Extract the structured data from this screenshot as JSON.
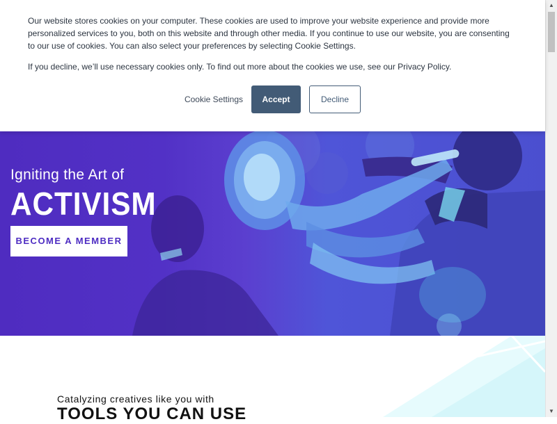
{
  "cookie_banner": {
    "paragraph_1": "Our website stores cookies on your computer. These cookies are used to improve your website experience and provide more personalized services to you, both on this website and through other media. If you continue to use our website, you are consenting to our use of cookies. You can also select your preferences by selecting Cookie Settings.",
    "paragraph_2": "If you decline, we’ll use necessary cookies only. To find out more about the cookies we use, see our Privacy Policy.",
    "settings_label": "Cookie Settings",
    "accept_label": "Accept",
    "decline_label": "Decline"
  },
  "hero": {
    "kicker": "Igniting the Art of",
    "title": "ACTIVISM",
    "cta_label": "BECOME A MEMBER"
  },
  "section": {
    "tagline": "Catalyzing creatives like you with",
    "title": "TOOLS YOU CAN USE"
  },
  "colors": {
    "accent": "#425b76",
    "hero_purple": "#5231c6",
    "cta_text": "#4d2cc2"
  }
}
